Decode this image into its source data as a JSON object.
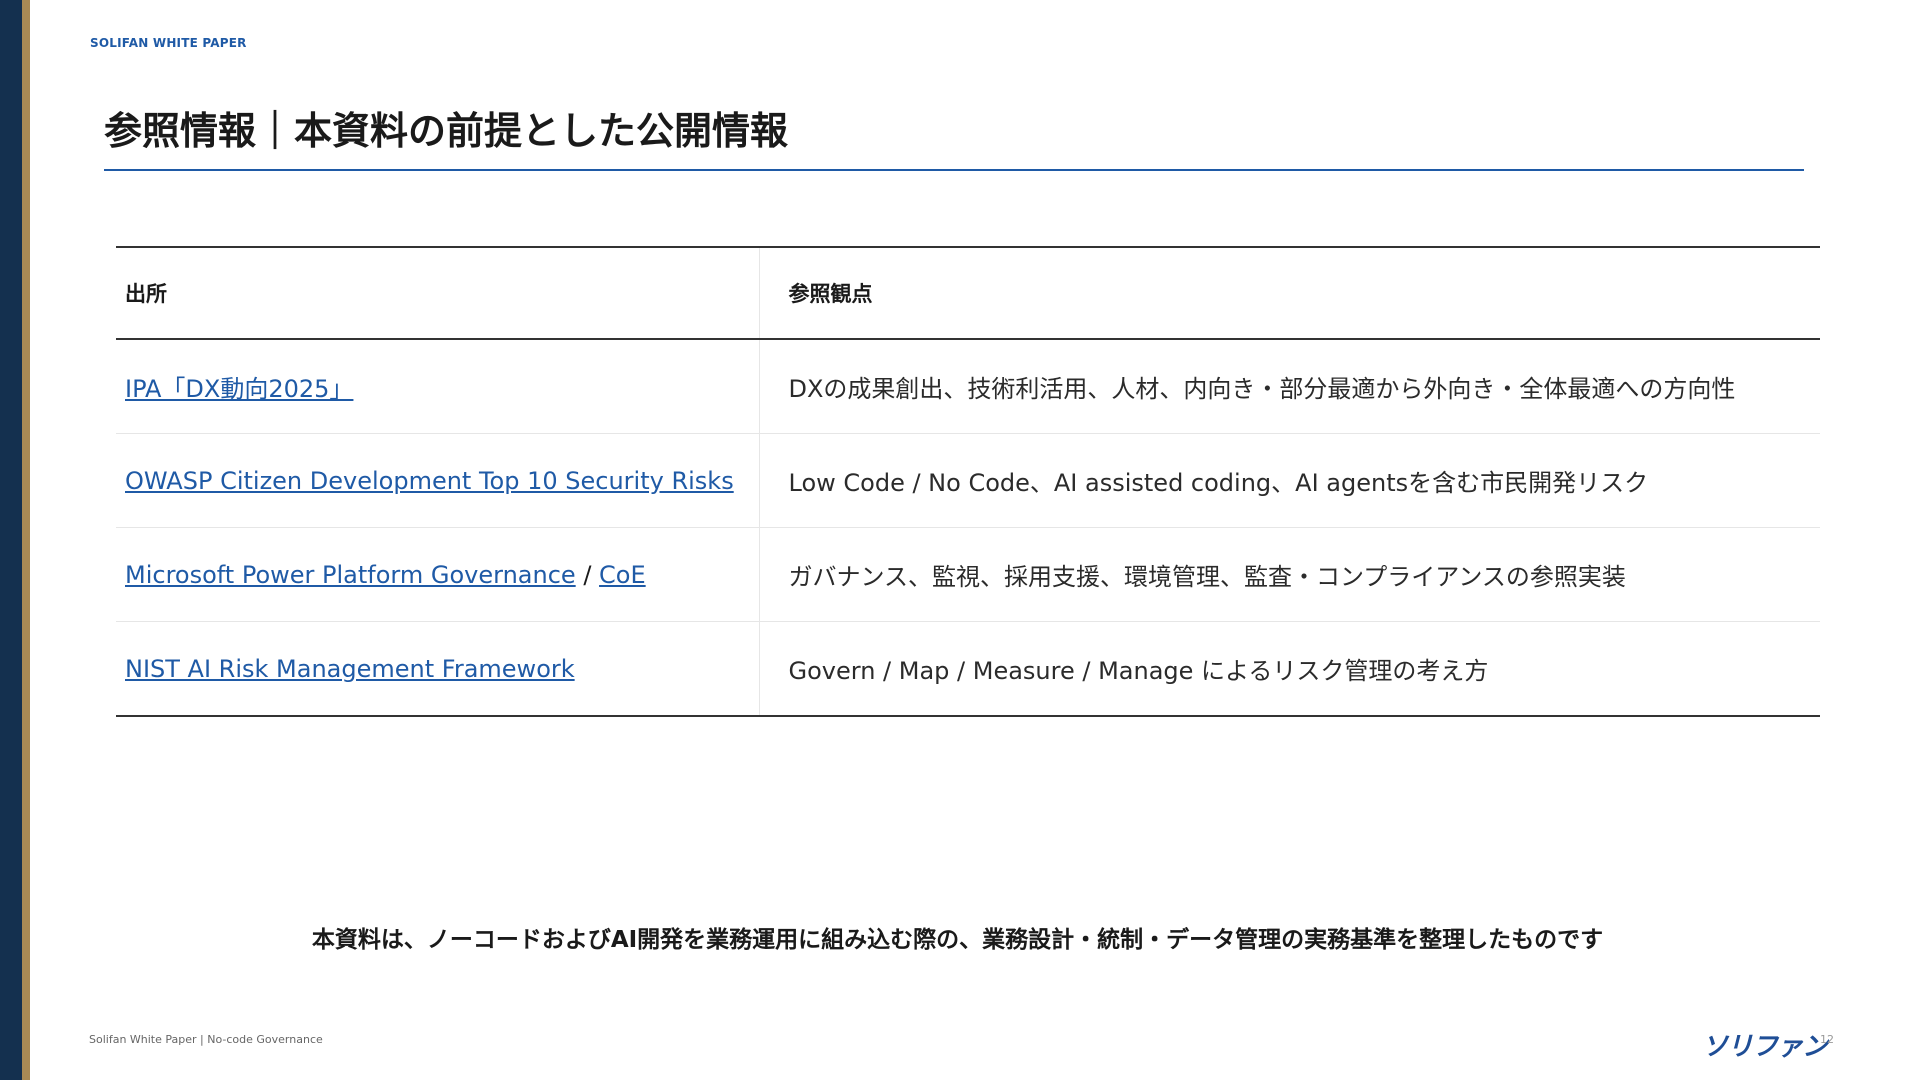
{
  "header": {
    "label": "SOLIFAN WHITE PAPER"
  },
  "page": {
    "title": "参照情報｜本資料の前提とした公開情報"
  },
  "table": {
    "headers": [
      "出所",
      "参照観点"
    ],
    "rows": [
      {
        "source": "IPA「DX動向2025」",
        "perspective": "DXの成果創出、技術利活用、人材、内向き・部分最適から外向き・全体最適への方向性"
      },
      {
        "source": "OWASP Citizen Development Top 10 Security Risks",
        "perspective": "Low Code / No Code、AI assisted coding、AI agentsを含む市民開発リスク"
      },
      {
        "source": "Microsoft Power Platform Governance",
        "separator": "/",
        "source_extra": "CoE",
        "perspective": "ガバナンス、監視、採用支援、環境管理、監査・コンプライアンスの参照実装"
      },
      {
        "source": "NIST AI Risk Management Framework",
        "perspective": "Govern / Map / Measure / Manage によるリスク管理の考え方"
      }
    ]
  },
  "summary": "本資料は、ノーコードおよびAI開発を業務運用に組み込む際の、業務設計・統制・データ管理の実務基準を整理したものです",
  "footer": {
    "text": "Solifan White Paper | No-code Governance",
    "brand": "ソリファン",
    "page_number": "12"
  },
  "colors": {
    "navy": "#14304f",
    "gold": "#a98a55",
    "accent_blue": "#1f5aa6"
  }
}
